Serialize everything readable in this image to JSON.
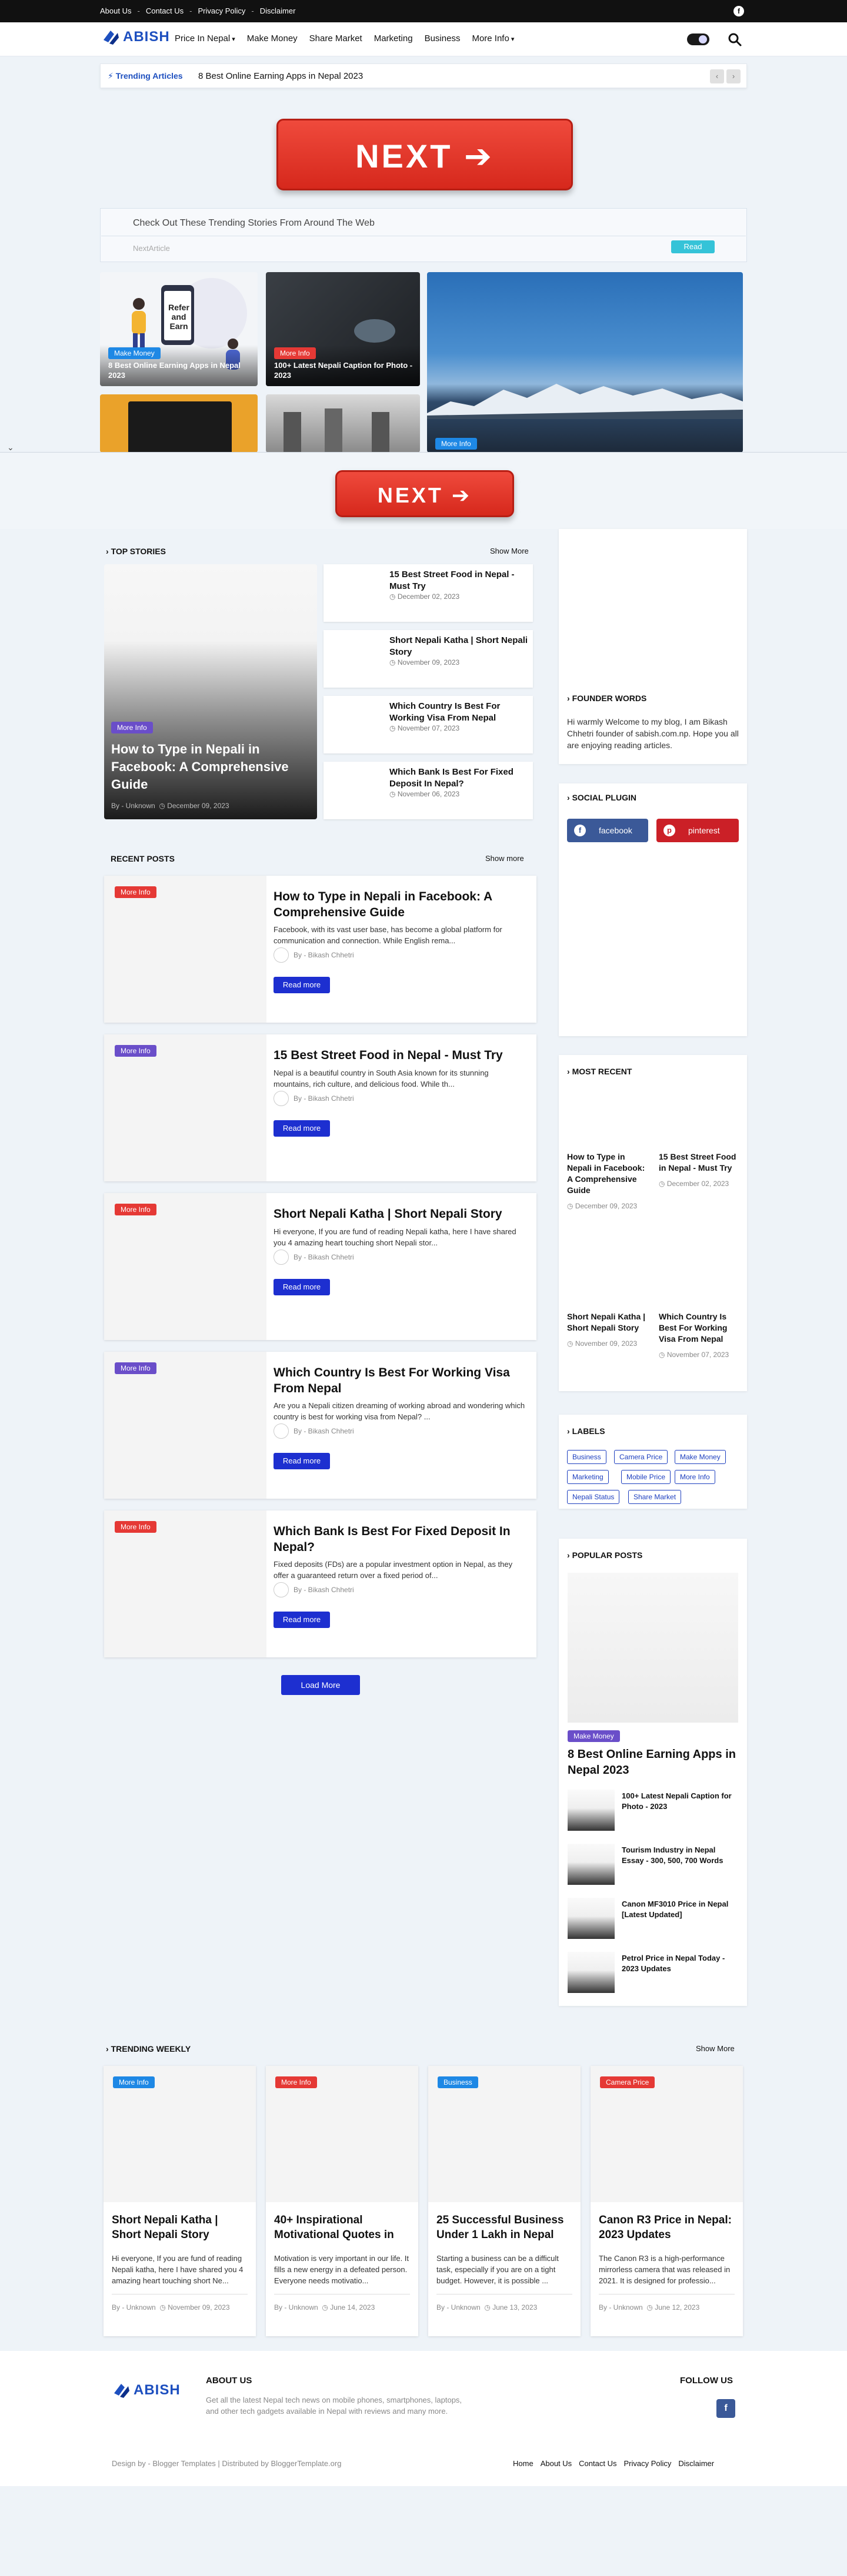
{
  "topbar": {
    "links": [
      "About Us",
      "Contact Us",
      "Privacy Policy",
      "Disclaimer"
    ]
  },
  "header": {
    "logo": "ABISH",
    "nav": [
      "Price In Nepal",
      "Make Money",
      "Share Market",
      "Marketing",
      "Business",
      "More Info"
    ]
  },
  "ticker": {
    "label": "Trending Articles",
    "text": "8 Best Online Earning Apps in Nepal 2023"
  },
  "next_button": "NEXT ➔",
  "trend_box": {
    "heading": "Check Out These Trending Stories From Around The Web",
    "next": "NextArticle",
    "read": "Read"
  },
  "featured": [
    {
      "badge": "Make Money",
      "caption": "8 Best Online Earning Apps in Nepal 2023",
      "art": "Refer and Earn"
    },
    {
      "badge": "More Info",
      "caption": "100+ Latest Nepali Caption for Photo - 2023"
    },
    {
      "badge": "More Info",
      "caption": ""
    }
  ],
  "top_stories": {
    "title": "Top Stories",
    "show_more": "Show More",
    "main": {
      "badge": "More Info",
      "title": "How to Type in Nepali in Facebook: A Comprehensive Guide",
      "author": "By - Unknown",
      "date": "December 09, 2023"
    },
    "side": [
      {
        "title": "15 Best Street Food in Nepal - Must Try",
        "date": "December 02, 2023"
      },
      {
        "title": "Short Nepali Katha | Short Nepali Story",
        "date": "November 09, 2023"
      },
      {
        "title": "Which Country Is Best For Working Visa From Nepal",
        "date": "November 07, 2023"
      },
      {
        "title": "Which Bank Is Best For Fixed Deposit In Nepal?",
        "date": "November 06, 2023"
      }
    ]
  },
  "recent": {
    "title": "Recent Posts",
    "show_more": "Show more",
    "read_more": "Read more",
    "load_more": "Load More",
    "posts": [
      {
        "badge": "More Info",
        "title": "How to Type in Nepali in Facebook: A Comprehensive Guide",
        "excerpt": "Facebook, with its vast user base, has become a global platform for communication and connection. While English rema...",
        "author": "By - Bikash Chhetri"
      },
      {
        "badge": "More Info",
        "title": "15 Best Street Food in Nepal - Must Try",
        "excerpt": "Nepal is a beautiful country in South Asia known for its stunning mountains, rich culture, and delicious food. While th...",
        "author": "By - Bikash Chhetri"
      },
      {
        "badge": "More Info",
        "title": "Short Nepali Katha | Short Nepali Story",
        "excerpt": "Hi everyone, If you are fund of reading Nepali katha, here I have shared you 4 amazing heart touching short Nepali stor...",
        "author": "By - Bikash Chhetri"
      },
      {
        "badge": "More Info",
        "title": "Which Country Is Best For Working Visa From Nepal",
        "excerpt": "Are you a Nepali citizen dreaming of working abroad and wondering which country is best for working visa from Nepal? ...",
        "author": "By - Bikash Chhetri"
      },
      {
        "badge": "More Info",
        "title": "Which Bank Is Best For Fixed Deposit In Nepal?",
        "excerpt": "Fixed deposits (FDs) are a popular investment option in Nepal, as they offer a guaranteed return over a fixed period of...",
        "author": "By - Bikash Chhetri"
      }
    ]
  },
  "sidebar": {
    "founder": {
      "title": "Founder Words",
      "text": "Hi warmly Welcome to my blog, I am Bikash Chhetri founder of sabish.com.np. Hope you all are enjoying reading articles."
    },
    "social": {
      "title": "Social Plugin",
      "facebook": "facebook",
      "pinterest": "pinterest"
    },
    "most_recent": {
      "title": "Most Recent",
      "items": [
        {
          "title": "How to Type in Nepali in Facebook: A Comprehensive Guide",
          "date": "December 09, 2023"
        },
        {
          "title": "15 Best Street Food in Nepal - Must Try",
          "date": "December 02, 2023"
        },
        {
          "title": "Short Nepali Katha | Short Nepali Story",
          "date": "November 09, 2023"
        },
        {
          "title": "Which Country Is Best For Working Visa From Nepal",
          "date": "November 07, 2023"
        }
      ]
    },
    "labels": {
      "title": "Labels",
      "items": [
        "Business",
        "Camera Price",
        "Make Money",
        "Marketing",
        "Mobile Price",
        "More Info",
        "Nepali Status",
        "Share Market"
      ]
    },
    "popular": {
      "title": "Popular Posts",
      "main": {
        "badge": "Make Money",
        "title": "8 Best Online Earning Apps in Nepal 2023"
      },
      "items": [
        "100+ Latest Nepali Caption for Photo - 2023",
        "Tourism Industry in Nepal Essay - 300, 500, 700 Words",
        "Canon MF3010 Price in Nepal [Latest Updated]",
        "Petrol Price in Nepal Today - 2023 Updates"
      ]
    }
  },
  "trending_weekly": {
    "title": "Trending Weekly",
    "show_more": "Show More",
    "cards": [
      {
        "badge": "More Info",
        "title": "Short Nepali Katha | Short Nepali Story",
        "excerpt": "Hi everyone, If you are fund of reading Nepali katha, here I have shared you 4 amazing heart touching short Ne...",
        "author": "By - Unknown",
        "date": "November 09, 2023"
      },
      {
        "badge": "More Info",
        "title": "40+ Inspirational Motivational Quotes in",
        "excerpt": "Motivation is very important in our life. It fills a new energy in a defeated person. Everyone needs motivatio...",
        "author": "By - Unknown",
        "date": "June 14, 2023"
      },
      {
        "badge": "Business",
        "title": "25 Successful Business Under 1 Lakh in Nepal",
        "excerpt": "Starting a business can be a difficult task, especially if you are on a tight budget. However, it is possible ...",
        "author": "By - Unknown",
        "date": "June 13, 2023"
      },
      {
        "badge": "Camera Price",
        "title": "Canon R3 Price in Nepal: 2023 Updates",
        "excerpt": "The Canon R3 is a high-performance mirrorless camera that was released in 2021. It is designed for professio...",
        "author": "By - Unknown",
        "date": "June 12, 2023"
      }
    ]
  },
  "footer": {
    "logo": "ABISH",
    "about_title": "About Us",
    "about_text": "Get all the latest Nepal tech news on mobile phones, smartphones, laptops, and other tech gadgets available in Nepal with reviews and many more.",
    "follow_title": "Follow Us",
    "credit": "Design by - Blogger Templates | Distributed by BloggerTemplate.org",
    "links": [
      "Home",
      "About Us",
      "Contact Us",
      "Privacy Policy",
      "Disclaimer"
    ]
  },
  "colors": {
    "accent": "#1d2fd0",
    "brand": "#1d4fbf",
    "red": "#e53935",
    "purple": "#6a4ec9",
    "blue": "#1e88e5"
  }
}
